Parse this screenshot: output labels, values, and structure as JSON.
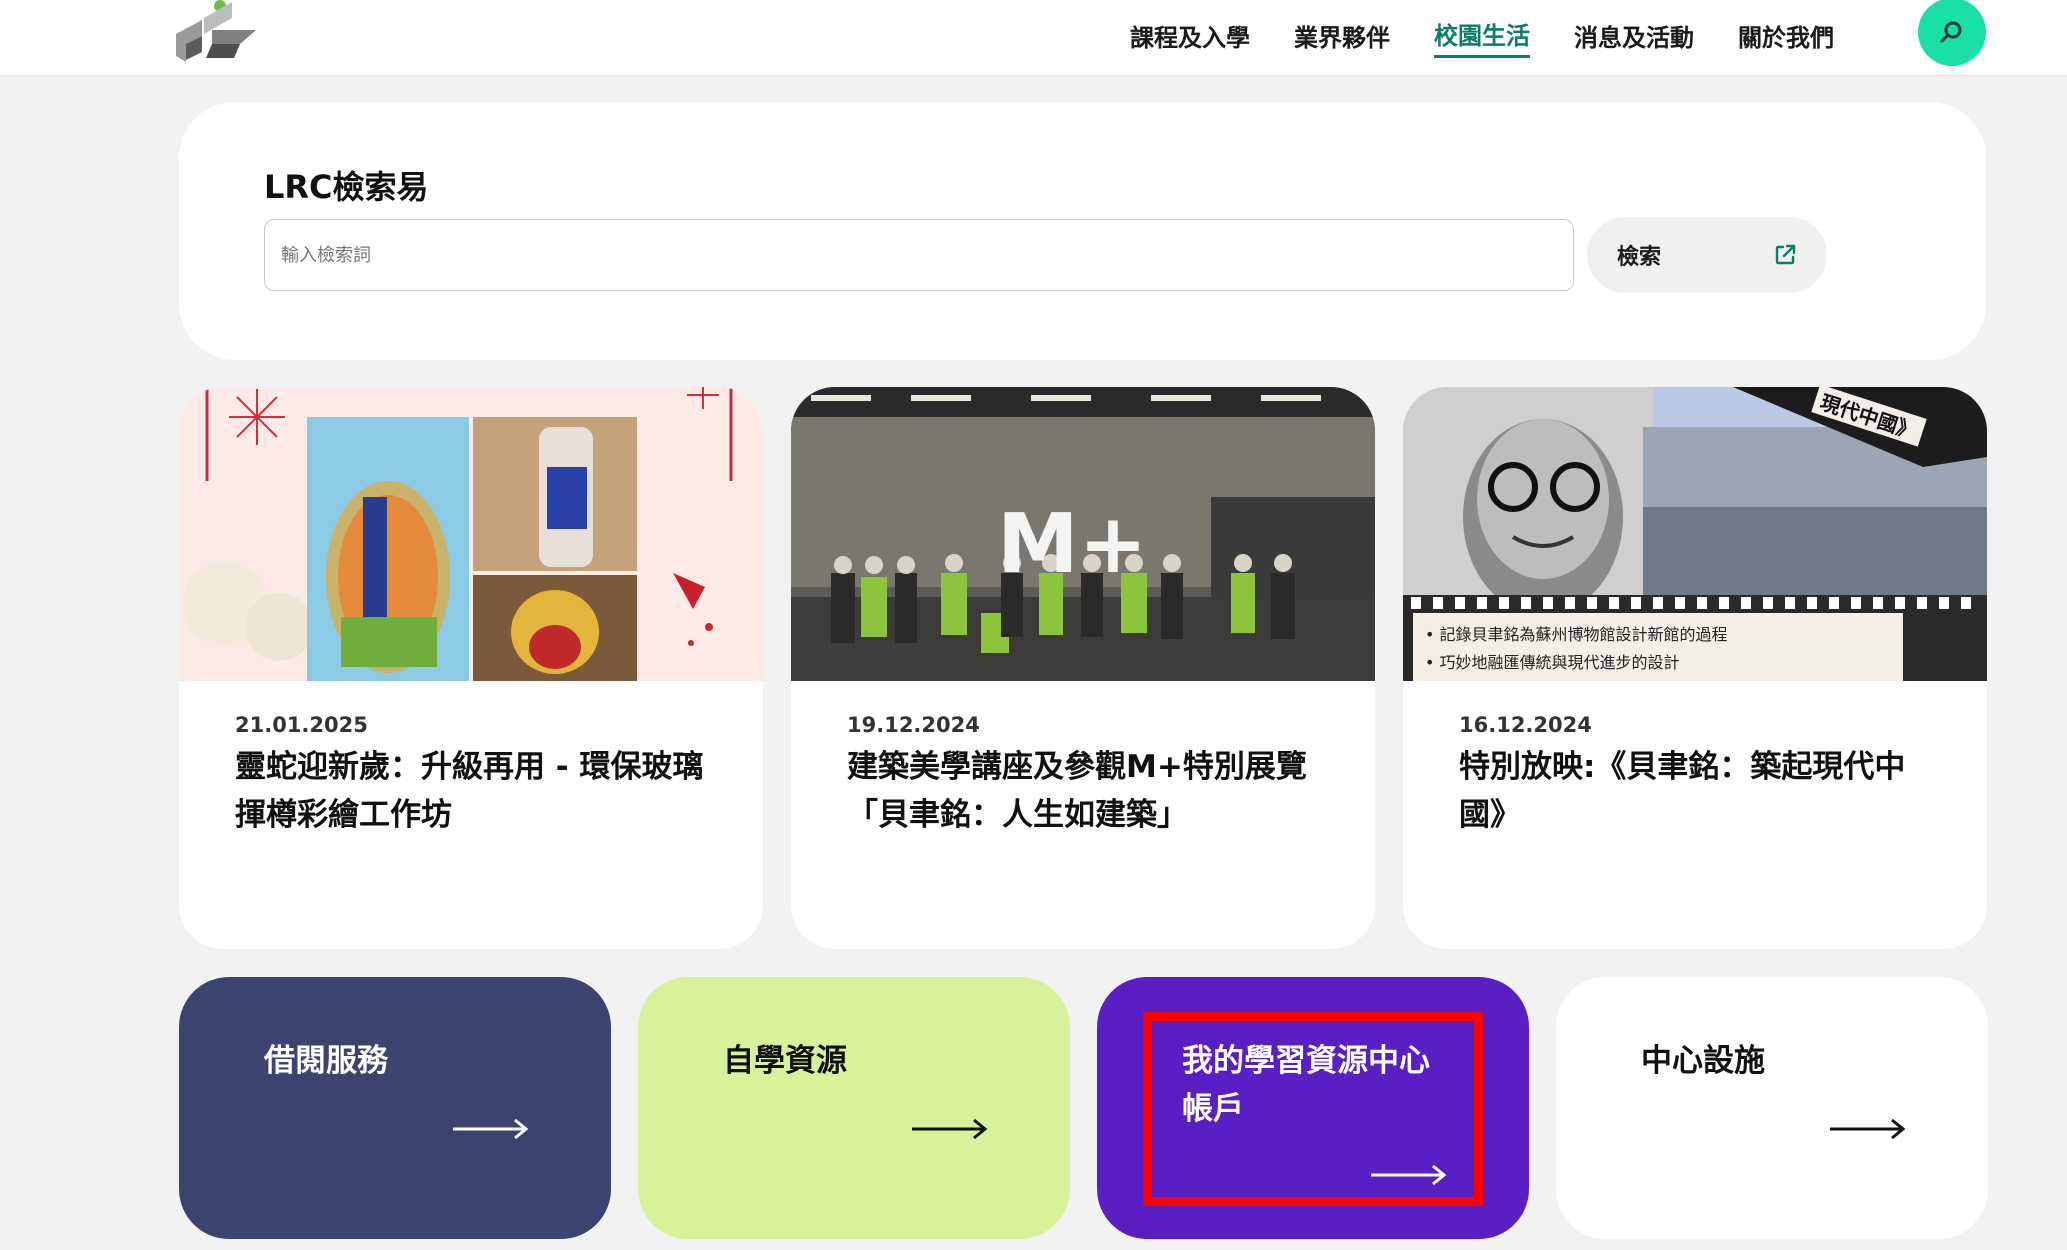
{
  "header": {
    "nav": [
      "課程及入學",
      "業界夥伴",
      "校園生活",
      "消息及活動",
      "關於我們"
    ],
    "active_nav": "校園生活"
  },
  "search": {
    "title": "LRC檢索易",
    "placeholder": "輸入檢索詞",
    "button_label": "檢索"
  },
  "news": [
    {
      "date": "21.01.2025",
      "title": "靈蛇迎新歲：升級再用 - 環保玻璃揮樽彩繪工作坊"
    },
    {
      "date": "19.12.2024",
      "title": "建築美學講座及參觀M+特別展覽「貝聿銘：人生如建築」",
      "image_text": "M+"
    },
    {
      "date": "16.12.2024",
      "title": "特別放映:《貝聿銘：築起現代中國》",
      "image_bullets": [
        "記錄貝聿銘為蘇州博物館設計新館的過程",
        "巧妙地融匯傳統與現代進步的設計"
      ],
      "image_banner": "現代中國》"
    }
  ],
  "quick_links": [
    {
      "label": "借閱服務",
      "bg": "#3b4371",
      "fg": "#ffffff"
    },
    {
      "label": "自學資源",
      "bg": "#d8f29a",
      "fg": "#111111"
    },
    {
      "label": "我的學習資源中心帳戶",
      "bg": "#5a1fc4",
      "fg": "#ffffff"
    },
    {
      "label": "中心設施",
      "bg": "#ffffff",
      "fg": "#111111"
    }
  ],
  "colors": {
    "accent": "#0e7c6b",
    "search_circle": "#19e0a7",
    "highlight": "#ff0000"
  }
}
